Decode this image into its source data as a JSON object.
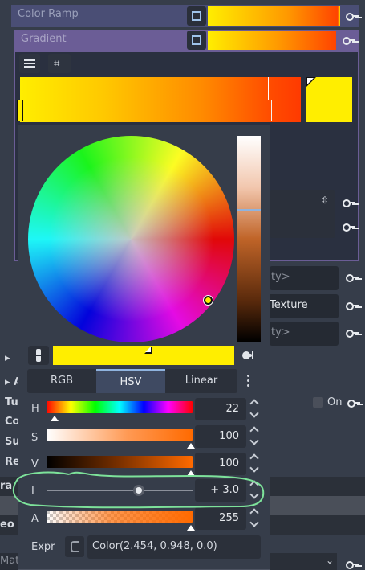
{
  "inspector": {
    "color_ramp_label": "Color Ramp",
    "gradient_label": "Gradient",
    "partial_right": {
      "empty1": "ty>",
      "texture": "Texture",
      "empty2": "ty>",
      "on_label": "On"
    },
    "partial_left": {
      "row1": "▸",
      "row2": "▸ A",
      "tu": "Tu",
      "co": "Co",
      "su": "Su",
      "re": "Re",
      "ra": "ra",
      "eo": "eo",
      "mat": "Mate"
    }
  },
  "color_picker": {
    "mode_tabs": [
      "RGB",
      "HSV",
      "Linear"
    ],
    "active_tab": "HSV",
    "channels": [
      {
        "label": "H",
        "value": "22",
        "fraction": 0.06
      },
      {
        "label": "S",
        "value": "100",
        "fraction": 1.0
      },
      {
        "label": "V",
        "value": "100",
        "fraction": 1.0
      },
      {
        "label": "I",
        "value": "+ 3.0",
        "fraction": 0.63
      },
      {
        "label": "A",
        "value": "255",
        "fraction": 1.0
      }
    ],
    "expr_label": "Expr",
    "expr_value": "Color(2.454, 0.948, 0.0)"
  },
  "colors": {
    "accent_highlight": "#7de29a",
    "selected_color": "#ffee00",
    "panel_bg": "#363d4a",
    "gradient_start": "#ffee00",
    "gradient_end": "#ff3300"
  }
}
